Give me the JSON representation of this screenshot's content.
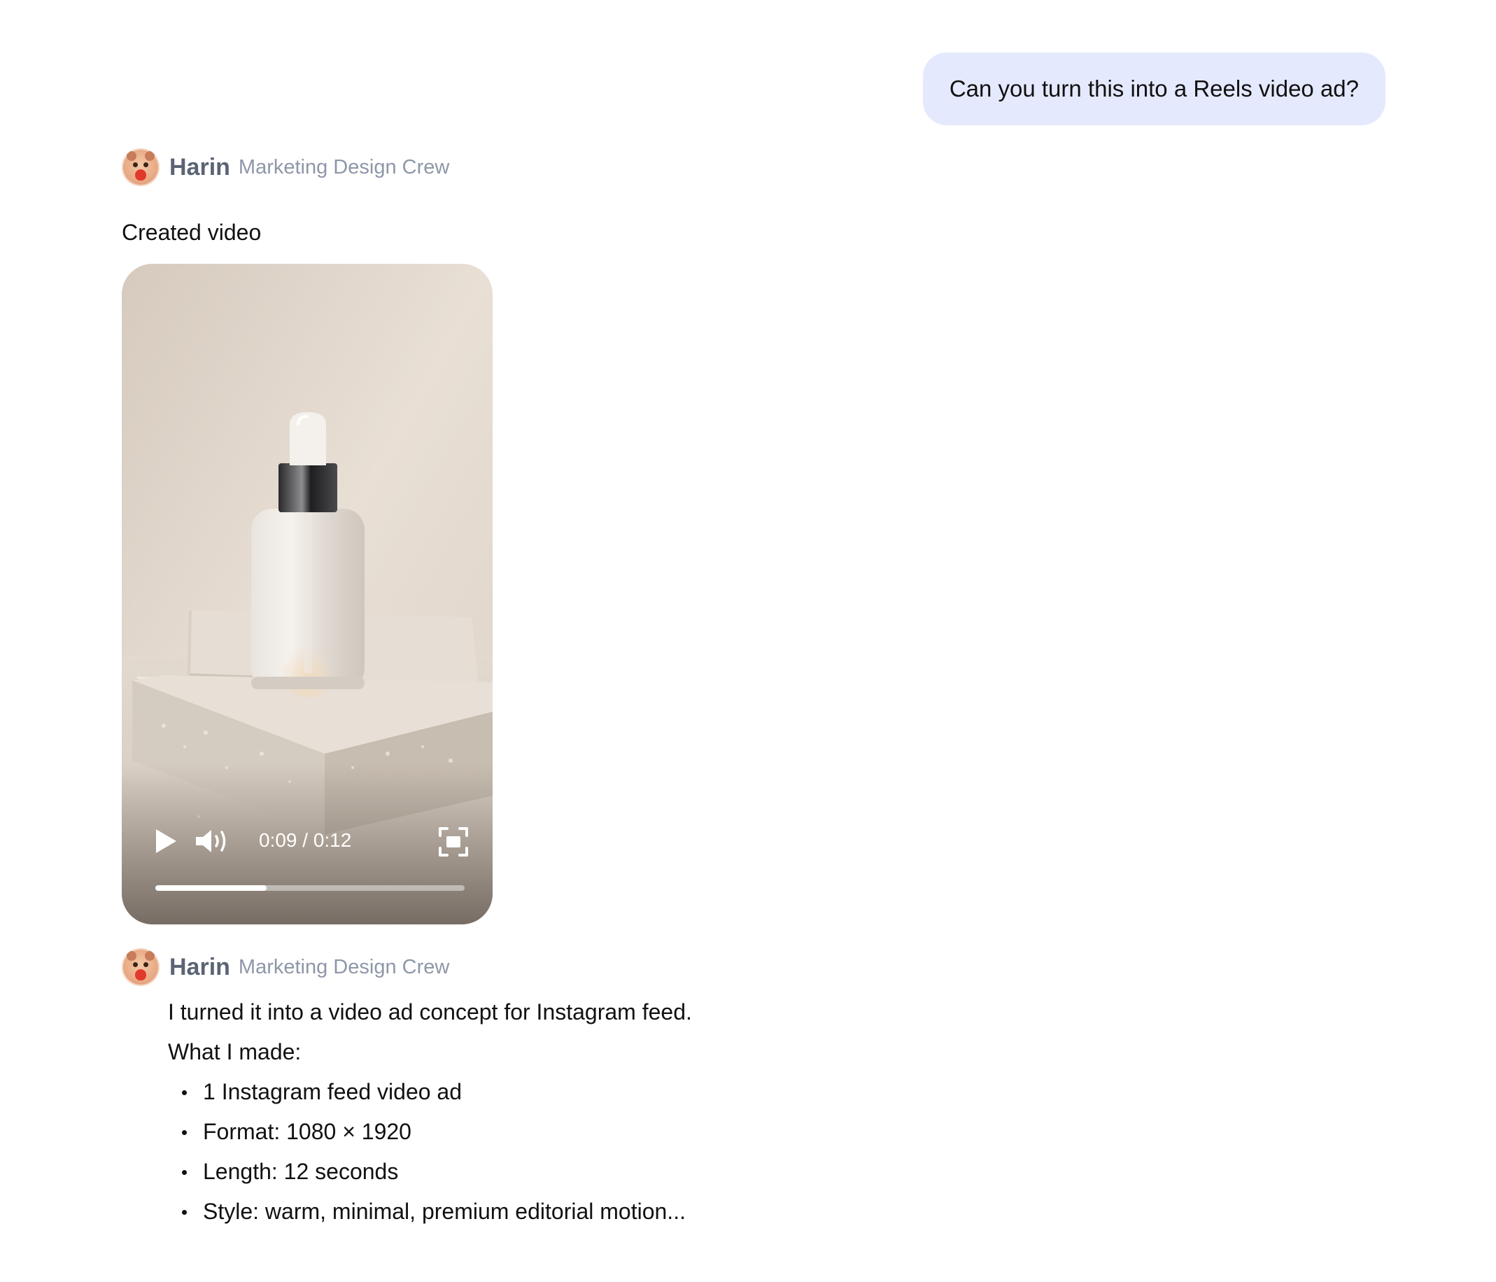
{
  "user_message": {
    "text": "Can you turn this into a Reels video ad?"
  },
  "agent": {
    "name": "Harin",
    "team": "Marketing Design Crew"
  },
  "created_label": "Created video",
  "video": {
    "time_display": "0:09 / 0:12",
    "progress": 0.36
  },
  "response": {
    "intro": "I turned it into a video ad concept for Instagram feed.",
    "list_heading": "What I made:",
    "items": [
      "1 Instagram feed video ad",
      "Format: 1080 × 1920",
      "Length: 12 seconds",
      "Style: warm, minimal, premium editorial motion..."
    ]
  },
  "colors": {
    "user_bubble_bg": "#e5e9fd",
    "agent_name": "#5b6474",
    "agent_team": "#8e97a8"
  }
}
